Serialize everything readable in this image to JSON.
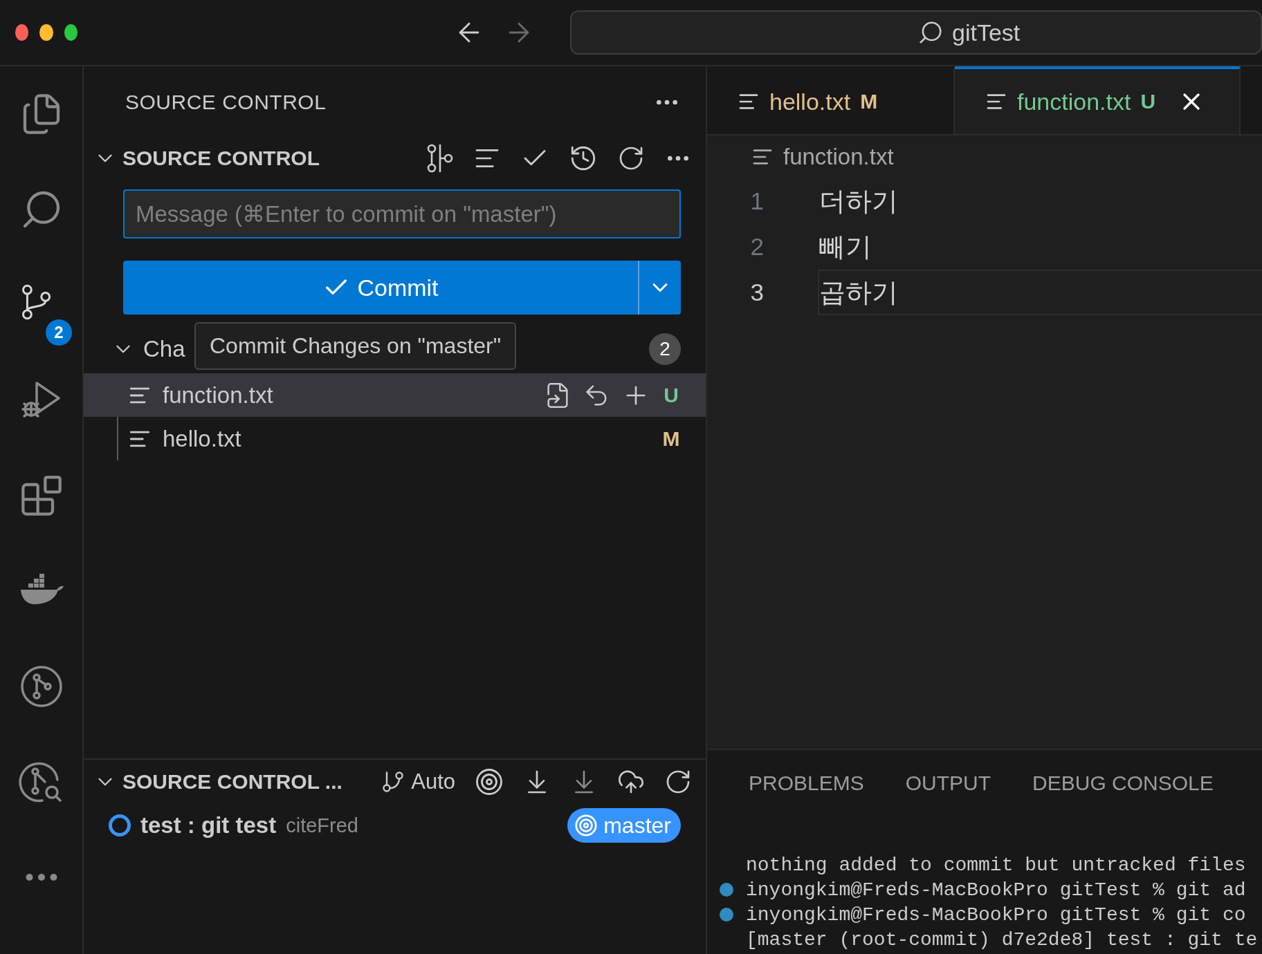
{
  "window": {
    "controls": [
      {
        "color": "#ff5f57"
      },
      {
        "color": "#febc2e"
      },
      {
        "color": "#28c840"
      }
    ],
    "navigation": [
      {
        "kind": "back",
        "disabled": false
      },
      {
        "kind": "forward",
        "disabled": true
      }
    ],
    "search": {
      "value": "gitTest"
    }
  },
  "activity_bar": {
    "items": [
      {
        "kind": "explorer",
        "selected": false
      },
      {
        "kind": "search",
        "selected": false
      },
      {
        "kind": "scm",
        "selected": true,
        "badge": "2"
      },
      {
        "kind": "debug",
        "selected": false
      },
      {
        "kind": "extensions",
        "selected": false
      },
      {
        "kind": "docker",
        "selected": false
      },
      {
        "kind": "graph",
        "selected": false
      },
      {
        "kind": "lens",
        "selected": false
      },
      {
        "kind": "more",
        "selected": false
      }
    ]
  },
  "sidebar": {
    "title": "SOURCE CONTROL",
    "source_control": {
      "title": "SOURCE CONTROL",
      "expanded": true,
      "message": {
        "placeholder": "Message (⌘Enter to commit on \"master\")"
      },
      "commit_button": {
        "label": "Commit"
      },
      "tooltip": "Commit Changes on \"master\"",
      "changes": {
        "label": "Cha",
        "expanded": true,
        "count": "2",
        "files": [
          {
            "name": "function.txt",
            "status": "U",
            "selected": true
          },
          {
            "name": "hello.txt",
            "status": "M",
            "selected": false
          }
        ]
      }
    },
    "graph": {
      "title": "SOURCE CONTROL ...",
      "expanded": true,
      "mode": "Auto",
      "commits": [
        {
          "message": "test : git test",
          "author": "citeFred",
          "branch": "master"
        }
      ]
    }
  },
  "editor": {
    "tabs": [
      {
        "name": "hello.txt",
        "status": "M",
        "selected": false
      },
      {
        "name": "function.txt",
        "status": "U",
        "selected": true
      }
    ],
    "breadcrumb": "function.txt",
    "lines": [
      {
        "number": "1",
        "text": "더하기",
        "current": false
      },
      {
        "number": "2",
        "text": "빼기",
        "current": false
      },
      {
        "number": "3",
        "text": "곱하기",
        "current": true
      }
    ]
  },
  "panel": {
    "tabs": [
      {
        "label": "PROBLEMS",
        "selected": false
      },
      {
        "label": "OUTPUT",
        "selected": false
      },
      {
        "label": "DEBUG CONSOLE",
        "selected": false
      }
    ],
    "terminal": [
      {
        "kind": "output",
        "text": "nothing added to commit but untracked files"
      },
      {
        "kind": "command",
        "text": "inyongkim@Freds-MacBookPro gitTest % git ad"
      },
      {
        "kind": "command",
        "text": "inyongkim@Freds-MacBookPro gitTest % git co"
      },
      {
        "kind": "output",
        "text": "[master (root-commit) d7e2de8] test : git te"
      }
    ]
  }
}
